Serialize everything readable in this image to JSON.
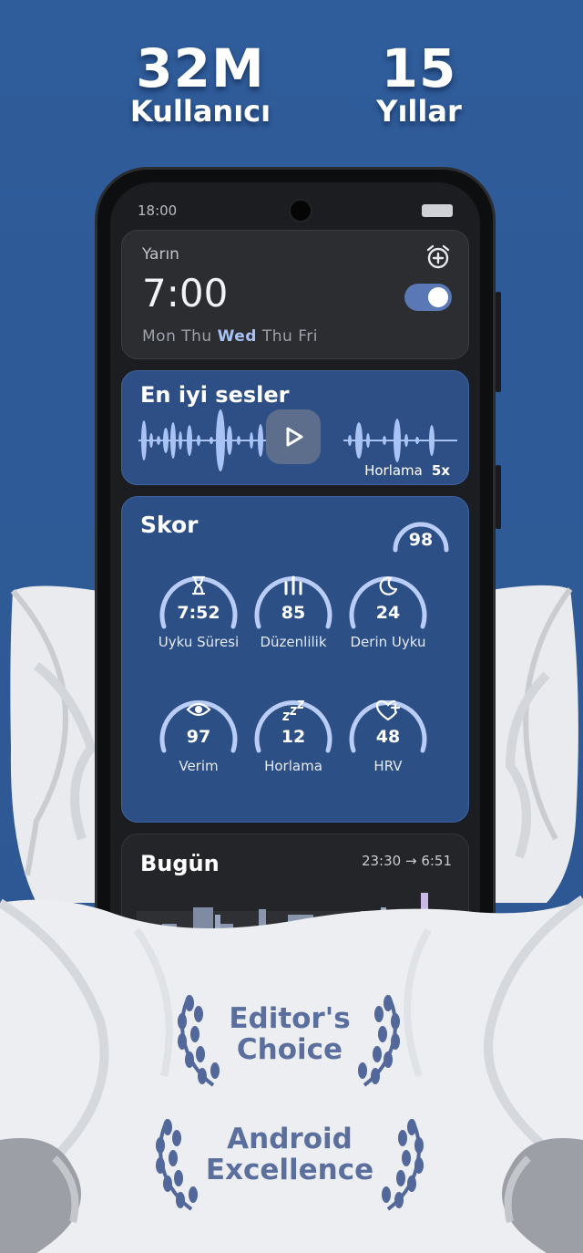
{
  "stats": [
    {
      "number": "32M",
      "label": "Kullanıcı"
    },
    {
      "number": "15",
      "label": "Yıllar"
    }
  ],
  "phone": {
    "status_time": "18:00",
    "alarm": {
      "label": "Yarın",
      "time": "7:00",
      "days": [
        "Mon",
        "Thu",
        "Wed",
        "Thu",
        "Fri"
      ],
      "highlighted_day": "Wed",
      "enabled": true
    },
    "sounds": {
      "title": "En iyi sesler",
      "tag": "Horlama",
      "count": "5x"
    },
    "score": {
      "title": "Skor",
      "total": "98",
      "metrics": [
        {
          "icon": "hourglass-icon",
          "value": "7:52",
          "label": "Uyku Süresi"
        },
        {
          "icon": "regularity-bars-icon",
          "value": "85",
          "label": "Düzenlilik"
        },
        {
          "icon": "moon-icon",
          "value": "24",
          "label": "Derin Uyku"
        },
        {
          "icon": "eye-icon",
          "value": "97",
          "label": "Verim"
        },
        {
          "icon": "zzz-icon",
          "value": "12",
          "label": "Horlama"
        },
        {
          "icon": "heart-plus-icon",
          "value": "48",
          "label": "HRV"
        }
      ]
    },
    "today": {
      "title": "Bugün",
      "start": "23:30",
      "arrow": "→",
      "end": "6:51"
    }
  },
  "badges": [
    {
      "line1": "Editor's",
      "line2": "Choice"
    },
    {
      "line1": "Android",
      "line2": "Excellence"
    }
  ],
  "colors": {
    "background": "#2f5b97",
    "card_blue": "#2c4f86",
    "accent": "#a7c2f6",
    "badge_text": "#5a6f9d"
  }
}
